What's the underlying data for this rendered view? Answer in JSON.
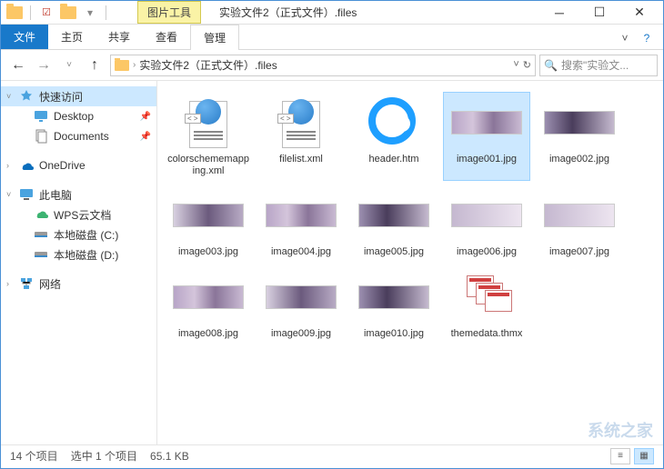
{
  "titlebar": {
    "contextual_tab": "图片工具",
    "window_title": "实验文件2（正式文件）.files"
  },
  "ribbon": {
    "file": "文件",
    "home": "主页",
    "share": "共享",
    "view": "查看",
    "manage": "管理"
  },
  "address": {
    "path": "实验文件2（正式文件）.files",
    "search_placeholder": "搜索\"实验文..."
  },
  "sidebar": {
    "quick_access": "快速访问",
    "desktop": "Desktop",
    "documents": "Documents",
    "onedrive": "OneDrive",
    "this_pc": "此电脑",
    "wps_cloud": "WPS云文档",
    "disk_c": "本地磁盘 (C:)",
    "disk_d": "本地磁盘 (D:)",
    "network": "网络"
  },
  "files": [
    {
      "name": "colorschememapping.xml",
      "type": "xml"
    },
    {
      "name": "filelist.xml",
      "type": "xml"
    },
    {
      "name": "header.htm",
      "type": "htm"
    },
    {
      "name": "image001.jpg",
      "type": "img",
      "selected": true,
      "variant": "v1"
    },
    {
      "name": "image002.jpg",
      "type": "img",
      "variant": "v2"
    },
    {
      "name": "image003.jpg",
      "type": "img",
      "variant": "v3"
    },
    {
      "name": "image004.jpg",
      "type": "img",
      "variant": "v1"
    },
    {
      "name": "image005.jpg",
      "type": "img",
      "variant": "v2"
    },
    {
      "name": "image006.jpg",
      "type": "img",
      "variant": "v4"
    },
    {
      "name": "image007.jpg",
      "type": "img",
      "variant": "v4"
    },
    {
      "name": "image008.jpg",
      "type": "img",
      "variant": "v1"
    },
    {
      "name": "image009.jpg",
      "type": "img",
      "variant": "v3"
    },
    {
      "name": "image010.jpg",
      "type": "img",
      "variant": "v2"
    },
    {
      "name": "themedata.thmx",
      "type": "thmx"
    }
  ],
  "status": {
    "count": "14 个项目",
    "selection": "选中 1 个项目",
    "size": "65.1 KB"
  },
  "watermark": "系统之家"
}
